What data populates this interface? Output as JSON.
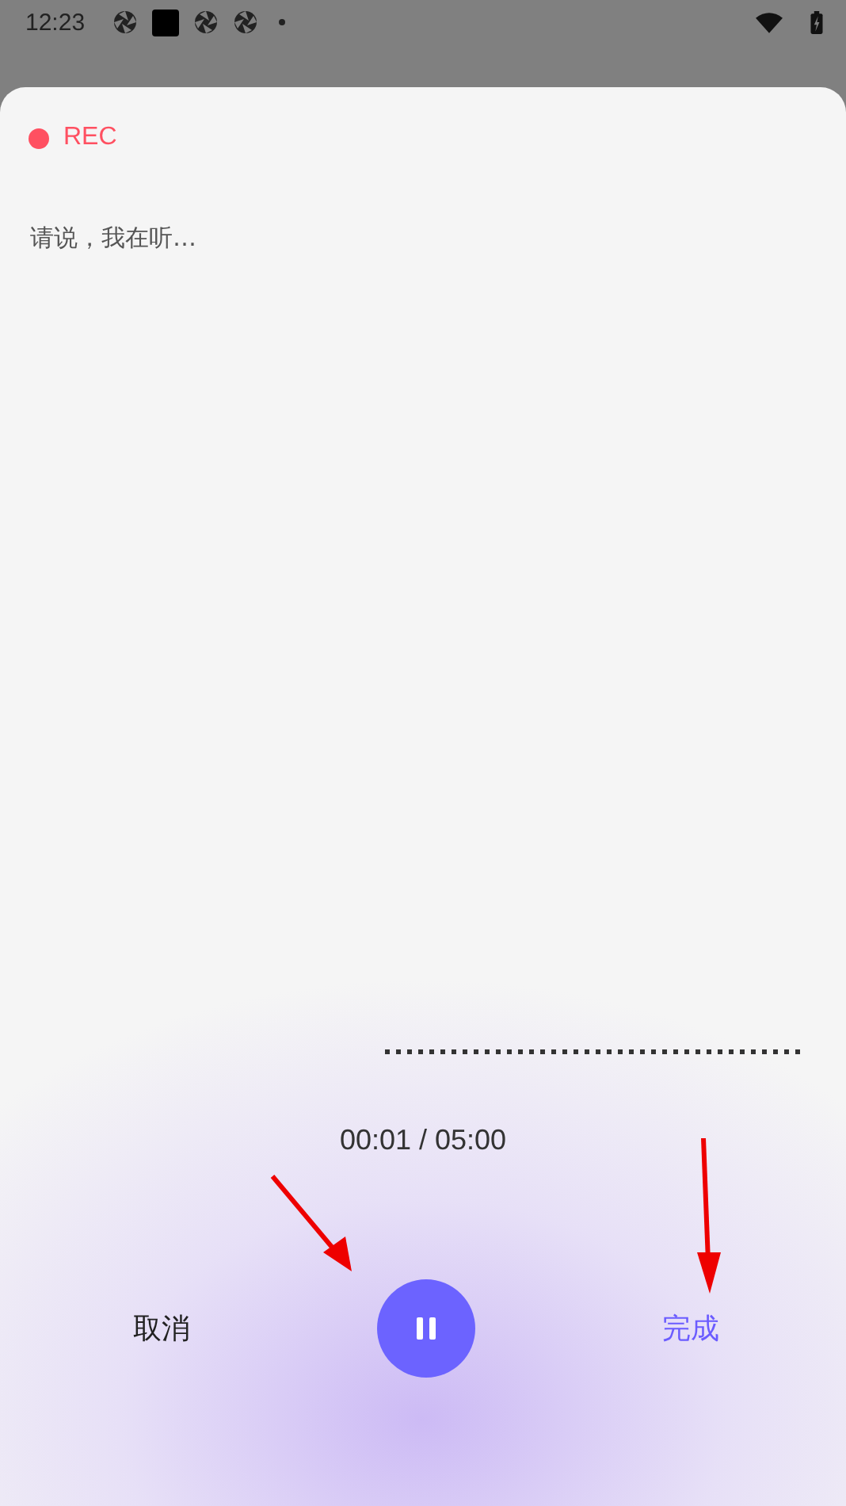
{
  "status_bar": {
    "time": "12:23"
  },
  "recorder": {
    "indicator": "REC",
    "prompt": "请说，我在听…",
    "timer": "00:01 / 05:00",
    "paused": false
  },
  "actions": {
    "cancel": "取消",
    "done": "完成"
  }
}
